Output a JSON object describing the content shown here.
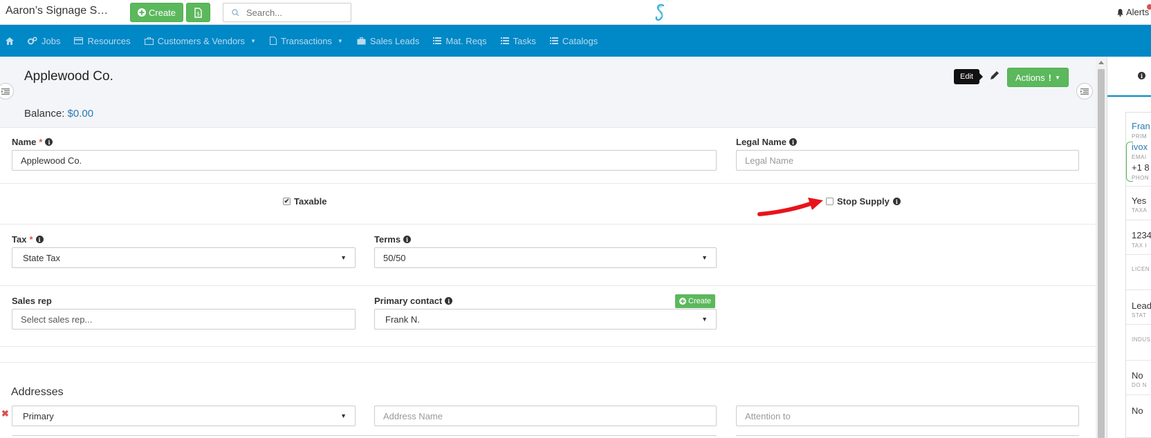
{
  "topbar": {
    "app_title": "Aaron’s Signage S…",
    "create_label": "Create",
    "search_placeholder": "Search...",
    "alerts_label": "Alerts"
  },
  "nav": {
    "items": [
      {
        "label": "",
        "icon": "home-icon"
      },
      {
        "label": "Jobs",
        "icon": "gears-icon"
      },
      {
        "label": "Resources",
        "icon": "card-icon"
      },
      {
        "label": "Customers & Vendors",
        "icon": "briefcase-icon",
        "dropdown": true
      },
      {
        "label": "Transactions",
        "icon": "file-icon",
        "dropdown": true
      },
      {
        "label": "Sales Leads",
        "icon": "briefcase-icon"
      },
      {
        "label": "Mat. Reqs",
        "icon": "list-icon"
      },
      {
        "label": "Tasks",
        "icon": "list-icon"
      },
      {
        "label": "Catalogs",
        "icon": "list-icon"
      }
    ]
  },
  "header": {
    "title": "Applewood Co.",
    "balance_label": "Balance:",
    "balance_value": "$0.00",
    "edit_tooltip": "Edit",
    "actions_label": "Actions"
  },
  "form": {
    "name_label": "Name",
    "name_value": "Applewood Co.",
    "legal_name_label": "Legal Name",
    "legal_name_placeholder": "Legal Name",
    "taxable_label": "Taxable",
    "taxable_checked": true,
    "stop_supply_label": "Stop Supply",
    "stop_supply_checked": false,
    "tax_label": "Tax",
    "tax_value": "State Tax",
    "terms_label": "Terms",
    "terms_value": "50/50",
    "sales_rep_label": "Sales rep",
    "sales_rep_placeholder": "Select sales rep...",
    "primary_contact_label": "Primary contact",
    "primary_contact_value": "Frank N.",
    "primary_contact_create": "Create",
    "addresses_title": "Addresses",
    "address_type_value": "Primary",
    "address_name_placeholder": "Address Name",
    "attention_placeholder": "Attention to"
  },
  "right_panel": {
    "contact_name": "Fran",
    "contact_sub": "PRIM",
    "email": "ivox",
    "email_sub": "EMAI",
    "phone": "+1 8",
    "phone_sub": "PHON",
    "taxable_value": "Yes",
    "taxable_sub": "TAXA",
    "tax_id_value": "1234",
    "tax_id_sub": "TAX I",
    "license_sub": "LICEN",
    "status_value": "Lead",
    "status_sub": "STAT",
    "industry_sub": "INDUS",
    "dnc_value": "No",
    "dnc_sub": "DO N",
    "last_value": "No"
  },
  "colors": {
    "nav_bg": "#0088c7",
    "success": "#5cb85c",
    "link": "#2a7ab0",
    "required": "#d9534f",
    "annotation_arrow": "#e8141b"
  }
}
